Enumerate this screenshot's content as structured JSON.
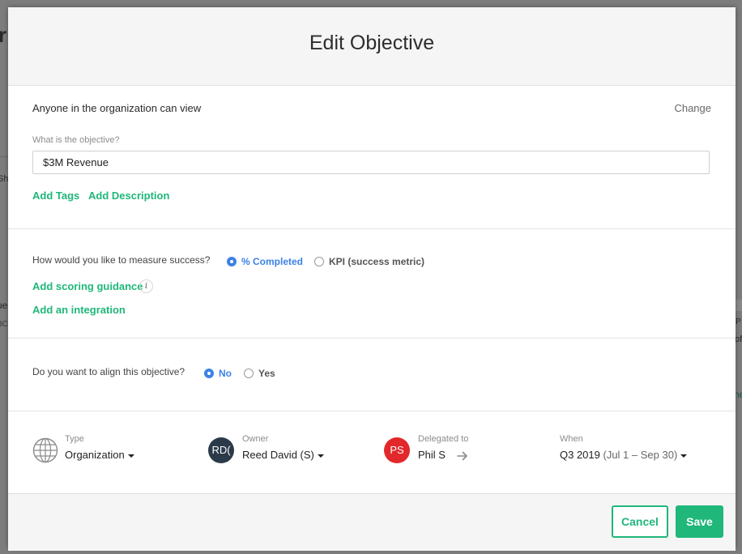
{
  "backdrop": {
    "fragment_1": "r",
    "fragment_2": "Sh",
    "fragment_3": "ue",
    "fragment_4": "3C",
    "fragment_5": "P",
    "fragment_6": "of",
    "fragment_7": "ne"
  },
  "modal": {
    "title": "Edit Objective"
  },
  "visibility": {
    "text": "Anyone in the organization can view",
    "change_label": "Change"
  },
  "objective": {
    "label": "What is the objective?",
    "value": "$3M Revenue",
    "add_tags": "Add Tags",
    "add_description": "Add Description"
  },
  "measure": {
    "question": "How would you like to measure success?",
    "options": [
      {
        "label": "% Completed",
        "selected": true
      },
      {
        "label": "KPI (success metric)",
        "selected": false
      }
    ],
    "add_scoring_guidance": "Add scoring guidance",
    "info_glyph": "i",
    "add_integration": "Add an integration"
  },
  "alignment": {
    "question": "Do you want to align this objective?",
    "options": [
      {
        "label": "No",
        "selected": true
      },
      {
        "label": "Yes",
        "selected": false
      }
    ]
  },
  "meta": {
    "type": {
      "label": "Type",
      "value": "Organization",
      "icon": "globe-icon"
    },
    "owner": {
      "label": "Owner",
      "value": "Reed David (S)",
      "initials": "RD(",
      "avatar_color": "#2b3a48"
    },
    "delegated": {
      "label": "Delegated to",
      "value": "Phil S",
      "initials": "PS",
      "avatar_color": "#e2282a",
      "icon": "arrow-right-icon"
    },
    "when": {
      "label": "When",
      "quarter": "Q3 2019",
      "range": "(Jul 1 – Sep 30)"
    }
  },
  "footer": {
    "cancel_label": "Cancel",
    "save_label": "Save"
  },
  "colors": {
    "accent_green": "#1fb77a",
    "radio_blue": "#3b82e6"
  }
}
